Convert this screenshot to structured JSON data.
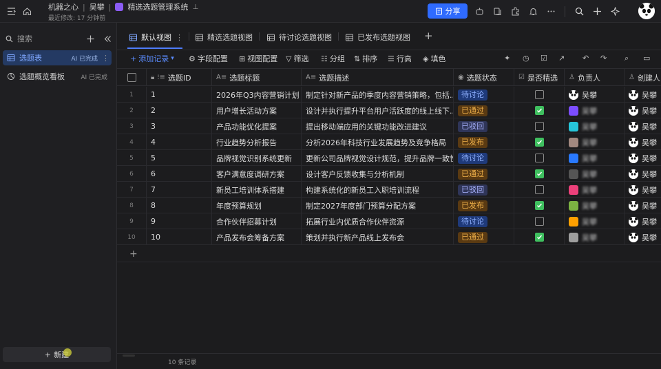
{
  "topbar": {
    "breadcrumb": [
      "机器之心",
      "吴攀"
    ],
    "app_name": "精选选题管理系统",
    "last_edit": "最近修改: 17 分钟前",
    "share_label": "分享"
  },
  "sidebar": {
    "search_placeholder": "搜索",
    "items": [
      {
        "label": "选题表",
        "tag": "AI 已完成",
        "icon": "table-icon",
        "active": true
      },
      {
        "label": "选题概览看板",
        "tag": "AI 已完成",
        "icon": "dashboard-icon",
        "active": false
      }
    ],
    "new_label": "新建"
  },
  "tabs": [
    {
      "label": "默认视图",
      "icon": "grid-icon",
      "active": true
    },
    {
      "label": "精选选题视图",
      "icon": "grid-icon",
      "active": false
    },
    {
      "label": "待讨论选题视图",
      "icon": "grid-icon",
      "active": false
    },
    {
      "label": "已发布选题视图",
      "icon": "grid-icon",
      "active": false
    }
  ],
  "toolbar": {
    "add_record": "添加记录",
    "field_config": "字段配置",
    "view_config": "视图配置",
    "filter": "筛选",
    "group": "分组",
    "sort": "排序",
    "row_height": "行高",
    "fill_color": "填色"
  },
  "columns": [
    "选题ID",
    "选题标题",
    "选题描述",
    "选题状态",
    "是否精选",
    "负责人",
    "创建人"
  ],
  "status_colors": {
    "待讨论": {
      "bg": "#1f3a7a",
      "fg": "#8fb0ff"
    },
    "已通过": {
      "bg": "#5a3a12",
      "fg": "#f0b14a"
    },
    "已驳回": {
      "bg": "#2f3558",
      "fg": "#aab4ff"
    },
    "已发布": {
      "bg": "#5a3a12",
      "fg": "#f0b14a"
    }
  },
  "rows": [
    {
      "num": "1",
      "id": "1",
      "title": "2026年Q3内容营销计划",
      "desc": "制定针对新产品的季度内容营销策略，包括...",
      "status": "待讨论",
      "featured": false,
      "owner": "吴攀",
      "owner_color": "#ffffff",
      "creator": "吴攀"
    },
    {
      "num": "2",
      "id": "2",
      "title": "用户增长活动方案",
      "desc": "设计并执行提升平台用户活跃度的线上线下...",
      "status": "已通过",
      "featured": true,
      "owner": "吴攀",
      "owner_color": "#7c4dff",
      "creator": "吴攀"
    },
    {
      "num": "3",
      "id": "3",
      "title": "产品功能优化提案",
      "desc": "提出移动端应用的关键功能改进建议",
      "status": "已驳回",
      "featured": false,
      "owner": "吴攀",
      "owner_color": "#26c6da",
      "creator": "吴攀"
    },
    {
      "num": "4",
      "id": "4",
      "title": "行业趋势分析报告",
      "desc": "分析2026年科技行业发展趋势及竞争格局",
      "status": "已发布",
      "featured": true,
      "owner": "吴攀",
      "owner_color": "#a1887f",
      "creator": "吴攀"
    },
    {
      "num": "5",
      "id": "5",
      "title": "品牌视觉识别系统更新",
      "desc": "更新公司品牌视觉设计规范，提升品牌一致性",
      "status": "待讨论",
      "featured": false,
      "owner": "吴攀",
      "owner_color": "#2979ff",
      "creator": "吴攀"
    },
    {
      "num": "6",
      "id": "6",
      "title": "客户满意度调研方案",
      "desc": "设计客户反馈收集与分析机制",
      "status": "已通过",
      "featured": true,
      "owner": "吴攀",
      "owner_color": "#555555",
      "creator": "吴攀"
    },
    {
      "num": "7",
      "id": "7",
      "title": "新员工培训体系搭建",
      "desc": "构建系统化的新员工入职培训流程",
      "status": "已驳回",
      "featured": false,
      "owner": "吴攀",
      "owner_color": "#ec407a",
      "creator": "吴攀"
    },
    {
      "num": "8",
      "id": "8",
      "title": "年度预算规划",
      "desc": "制定2027年度部门预算分配方案",
      "status": "已发布",
      "featured": true,
      "owner": "吴攀",
      "owner_color": "#7cb342",
      "creator": "吴攀"
    },
    {
      "num": "9",
      "id": "9",
      "title": "合作伙伴招募计划",
      "desc": "拓展行业内优质合作伙伴资源",
      "status": "待讨论",
      "featured": false,
      "owner": "吴攀",
      "owner_color": "#ffa000",
      "creator": "吴攀"
    },
    {
      "num": "10",
      "id": "10",
      "title": "产品发布会筹备方案",
      "desc": "策划并执行新产品线上发布会",
      "status": "已通过",
      "featured": true,
      "owner": "吴攀",
      "owner_color": "#9e9e9e",
      "creator": "吴攀"
    }
  ],
  "footer": {
    "record_count": "10 条记录"
  }
}
